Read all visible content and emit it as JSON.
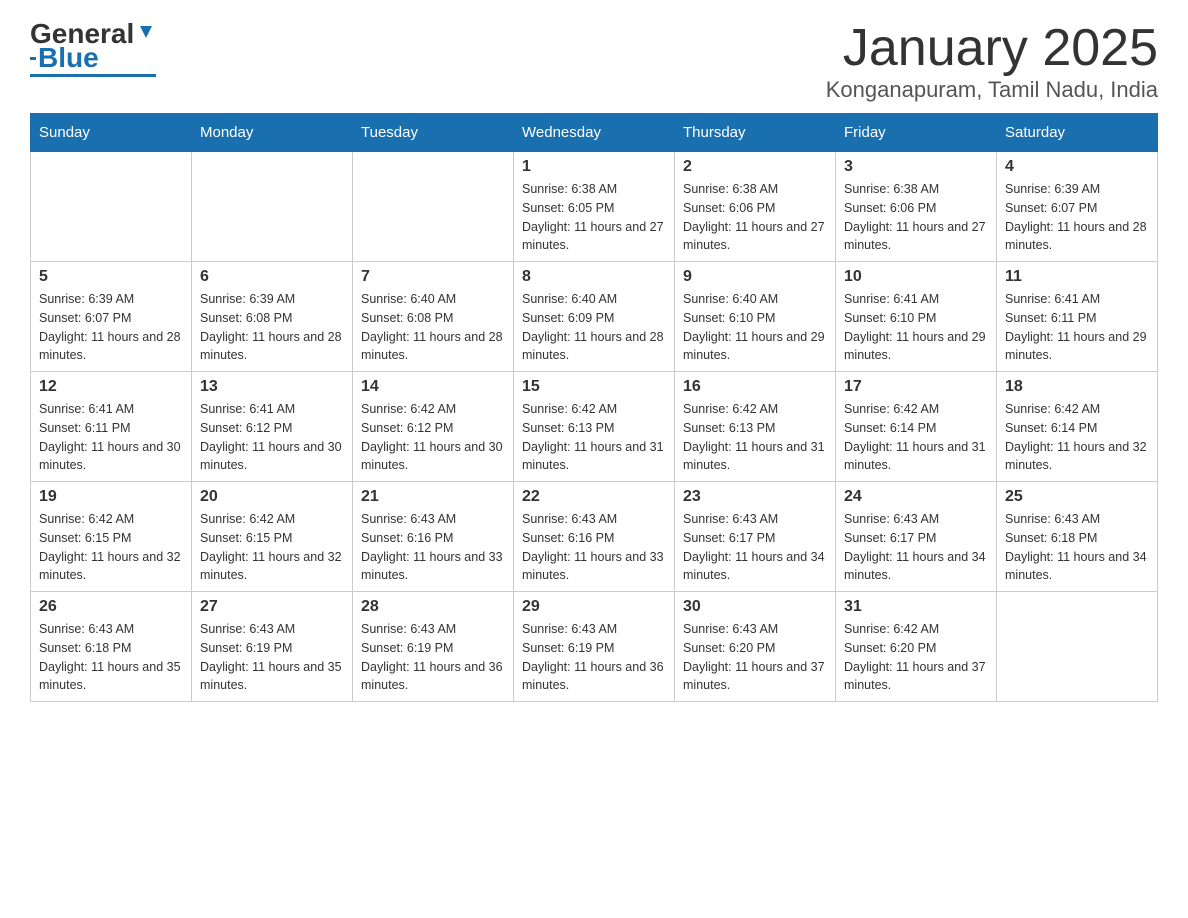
{
  "logo": {
    "text_general": "General",
    "text_blue": "Blue"
  },
  "title": "January 2025",
  "subtitle": "Konganapuram, Tamil Nadu, India",
  "days_of_week": [
    "Sunday",
    "Monday",
    "Tuesday",
    "Wednesday",
    "Thursday",
    "Friday",
    "Saturday"
  ],
  "weeks": [
    [
      {
        "day": "",
        "info": ""
      },
      {
        "day": "",
        "info": ""
      },
      {
        "day": "",
        "info": ""
      },
      {
        "day": "1",
        "info": "Sunrise: 6:38 AM\nSunset: 6:05 PM\nDaylight: 11 hours and 27 minutes."
      },
      {
        "day": "2",
        "info": "Sunrise: 6:38 AM\nSunset: 6:06 PM\nDaylight: 11 hours and 27 minutes."
      },
      {
        "day": "3",
        "info": "Sunrise: 6:38 AM\nSunset: 6:06 PM\nDaylight: 11 hours and 27 minutes."
      },
      {
        "day": "4",
        "info": "Sunrise: 6:39 AM\nSunset: 6:07 PM\nDaylight: 11 hours and 28 minutes."
      }
    ],
    [
      {
        "day": "5",
        "info": "Sunrise: 6:39 AM\nSunset: 6:07 PM\nDaylight: 11 hours and 28 minutes."
      },
      {
        "day": "6",
        "info": "Sunrise: 6:39 AM\nSunset: 6:08 PM\nDaylight: 11 hours and 28 minutes."
      },
      {
        "day": "7",
        "info": "Sunrise: 6:40 AM\nSunset: 6:08 PM\nDaylight: 11 hours and 28 minutes."
      },
      {
        "day": "8",
        "info": "Sunrise: 6:40 AM\nSunset: 6:09 PM\nDaylight: 11 hours and 28 minutes."
      },
      {
        "day": "9",
        "info": "Sunrise: 6:40 AM\nSunset: 6:10 PM\nDaylight: 11 hours and 29 minutes."
      },
      {
        "day": "10",
        "info": "Sunrise: 6:41 AM\nSunset: 6:10 PM\nDaylight: 11 hours and 29 minutes."
      },
      {
        "day": "11",
        "info": "Sunrise: 6:41 AM\nSunset: 6:11 PM\nDaylight: 11 hours and 29 minutes."
      }
    ],
    [
      {
        "day": "12",
        "info": "Sunrise: 6:41 AM\nSunset: 6:11 PM\nDaylight: 11 hours and 30 minutes."
      },
      {
        "day": "13",
        "info": "Sunrise: 6:41 AM\nSunset: 6:12 PM\nDaylight: 11 hours and 30 minutes."
      },
      {
        "day": "14",
        "info": "Sunrise: 6:42 AM\nSunset: 6:12 PM\nDaylight: 11 hours and 30 minutes."
      },
      {
        "day": "15",
        "info": "Sunrise: 6:42 AM\nSunset: 6:13 PM\nDaylight: 11 hours and 31 minutes."
      },
      {
        "day": "16",
        "info": "Sunrise: 6:42 AM\nSunset: 6:13 PM\nDaylight: 11 hours and 31 minutes."
      },
      {
        "day": "17",
        "info": "Sunrise: 6:42 AM\nSunset: 6:14 PM\nDaylight: 11 hours and 31 minutes."
      },
      {
        "day": "18",
        "info": "Sunrise: 6:42 AM\nSunset: 6:14 PM\nDaylight: 11 hours and 32 minutes."
      }
    ],
    [
      {
        "day": "19",
        "info": "Sunrise: 6:42 AM\nSunset: 6:15 PM\nDaylight: 11 hours and 32 minutes."
      },
      {
        "day": "20",
        "info": "Sunrise: 6:42 AM\nSunset: 6:15 PM\nDaylight: 11 hours and 32 minutes."
      },
      {
        "day": "21",
        "info": "Sunrise: 6:43 AM\nSunset: 6:16 PM\nDaylight: 11 hours and 33 minutes."
      },
      {
        "day": "22",
        "info": "Sunrise: 6:43 AM\nSunset: 6:16 PM\nDaylight: 11 hours and 33 minutes."
      },
      {
        "day": "23",
        "info": "Sunrise: 6:43 AM\nSunset: 6:17 PM\nDaylight: 11 hours and 34 minutes."
      },
      {
        "day": "24",
        "info": "Sunrise: 6:43 AM\nSunset: 6:17 PM\nDaylight: 11 hours and 34 minutes."
      },
      {
        "day": "25",
        "info": "Sunrise: 6:43 AM\nSunset: 6:18 PM\nDaylight: 11 hours and 34 minutes."
      }
    ],
    [
      {
        "day": "26",
        "info": "Sunrise: 6:43 AM\nSunset: 6:18 PM\nDaylight: 11 hours and 35 minutes."
      },
      {
        "day": "27",
        "info": "Sunrise: 6:43 AM\nSunset: 6:19 PM\nDaylight: 11 hours and 35 minutes."
      },
      {
        "day": "28",
        "info": "Sunrise: 6:43 AM\nSunset: 6:19 PM\nDaylight: 11 hours and 36 minutes."
      },
      {
        "day": "29",
        "info": "Sunrise: 6:43 AM\nSunset: 6:19 PM\nDaylight: 11 hours and 36 minutes."
      },
      {
        "day": "30",
        "info": "Sunrise: 6:43 AM\nSunset: 6:20 PM\nDaylight: 11 hours and 37 minutes."
      },
      {
        "day": "31",
        "info": "Sunrise: 6:42 AM\nSunset: 6:20 PM\nDaylight: 11 hours and 37 minutes."
      },
      {
        "day": "",
        "info": ""
      }
    ]
  ]
}
